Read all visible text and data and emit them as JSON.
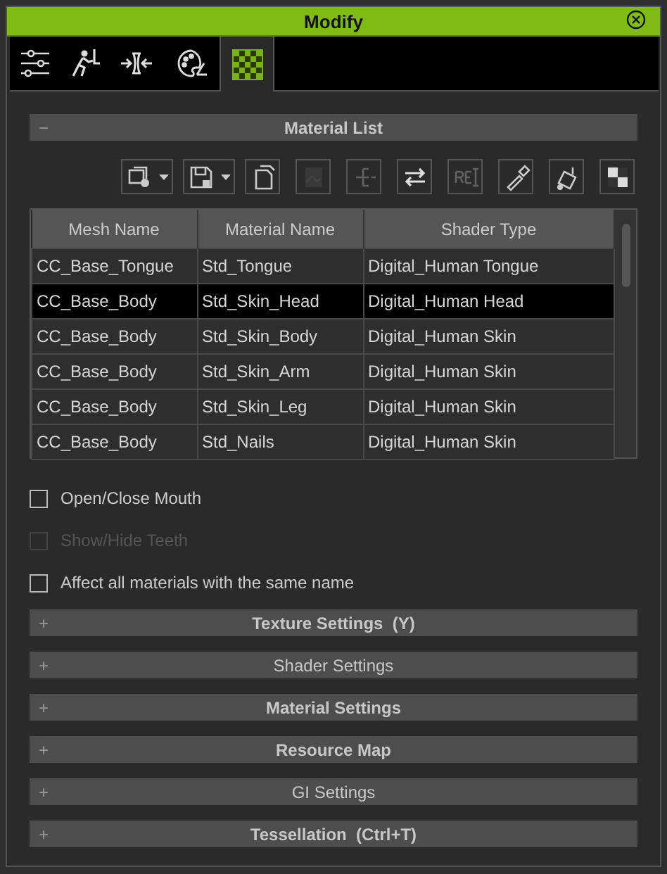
{
  "window": {
    "title": "Modify"
  },
  "tabs": [
    {
      "selected": false
    },
    {
      "selected": false
    },
    {
      "selected": false
    },
    {
      "selected": false
    },
    {
      "selected": true
    }
  ],
  "material_list": {
    "toggle": "−",
    "title": "Material List",
    "toolbar": [
      {
        "kind": "dropdown",
        "disabled": false
      },
      {
        "kind": "dropdown",
        "disabled": false
      },
      {
        "kind": "button",
        "disabled": false
      },
      {
        "kind": "button",
        "disabled": true
      },
      {
        "kind": "button",
        "disabled": true
      },
      {
        "kind": "button",
        "disabled": false
      },
      {
        "kind": "button",
        "disabled": true
      },
      {
        "kind": "button",
        "disabled": false
      },
      {
        "kind": "button",
        "disabled": false
      },
      {
        "kind": "button",
        "disabled": false
      }
    ],
    "table": {
      "columns": [
        "Mesh Name",
        "Material Name",
        "Shader Type"
      ],
      "rows": [
        {
          "cells": [
            "CC_Base_Tongue",
            "Std_Tongue",
            "Digital_Human Tongue"
          ],
          "selected": false
        },
        {
          "cells": [
            "CC_Base_Body",
            "Std_Skin_Head",
            "Digital_Human Head"
          ],
          "selected": true
        },
        {
          "cells": [
            "CC_Base_Body",
            "Std_Skin_Body",
            "Digital_Human Skin"
          ],
          "selected": false
        },
        {
          "cells": [
            "CC_Base_Body",
            "Std_Skin_Arm",
            "Digital_Human Skin"
          ],
          "selected": false
        },
        {
          "cells": [
            "CC_Base_Body",
            "Std_Skin_Leg",
            "Digital_Human Skin"
          ],
          "selected": false
        },
        {
          "cells": [
            "CC_Base_Body",
            "Std_Nails",
            "Digital_Human Skin"
          ],
          "selected": false
        }
      ]
    },
    "options": [
      {
        "label": "Open/Close Mouth",
        "checked": false,
        "disabled": false
      },
      {
        "label": "Show/Hide Teeth",
        "checked": false,
        "disabled": true
      },
      {
        "label": "Affect all materials with the same name",
        "checked": false,
        "disabled": false
      }
    ]
  },
  "sections": [
    {
      "toggle": "+",
      "title": "Texture Settings  (Y)",
      "bold": true
    },
    {
      "toggle": "+",
      "title": "Shader Settings",
      "bold": false
    },
    {
      "toggle": "+",
      "title": "Material Settings",
      "bold": true
    },
    {
      "toggle": "+",
      "title": "Resource Map",
      "bold": true
    },
    {
      "toggle": "+",
      "title": "GI Settings",
      "bold": false
    },
    {
      "toggle": "+",
      "title": "Tessellation  (Ctrl+T)",
      "bold": true
    }
  ]
}
